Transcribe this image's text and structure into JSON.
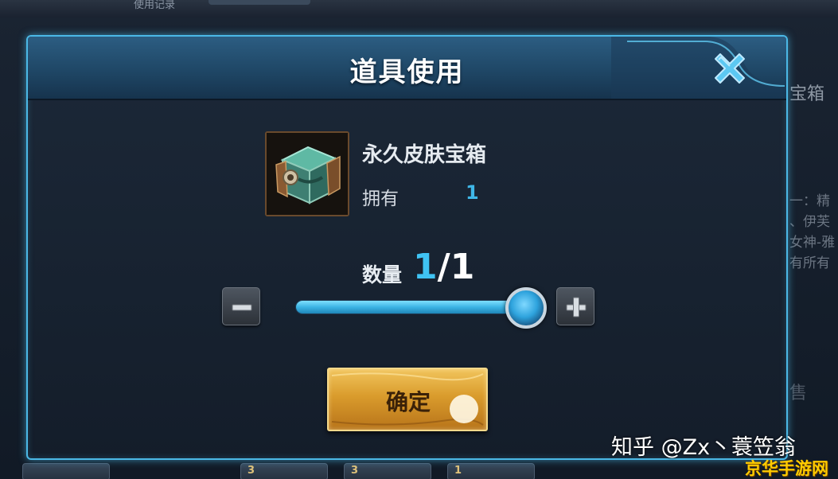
{
  "background": {
    "top_left_label": "使用记录",
    "side_title": "宝箱",
    "side_desc_lines": [
      "一：精",
      "、伊芙",
      "女神-雅",
      "有所有"
    ],
    "side_sell": "售",
    "bottom_items": [
      "3",
      "3",
      "1"
    ]
  },
  "dialog": {
    "title": "道具使用",
    "close_icon": "close-x-icon"
  },
  "item": {
    "icon": "treasure-chest-icon",
    "name": "永久皮肤宝箱",
    "own_label": "拥有",
    "own_count": "1"
  },
  "quantity": {
    "label": "数量",
    "current": "1",
    "slash": "/",
    "max": "1",
    "level": 1.0
  },
  "buttons": {
    "minus_icon": "minus-icon",
    "plus_icon": "plus-icon",
    "confirm_label": "确定"
  },
  "watermarks": {
    "zhihu": "知乎 @Zx丶蓑笠翁",
    "site": "京华手游网"
  },
  "colors": {
    "frame_glow": "#4bb8e6",
    "accent_blue": "#3fc3f3",
    "confirm_gold": "#d99b2c"
  }
}
